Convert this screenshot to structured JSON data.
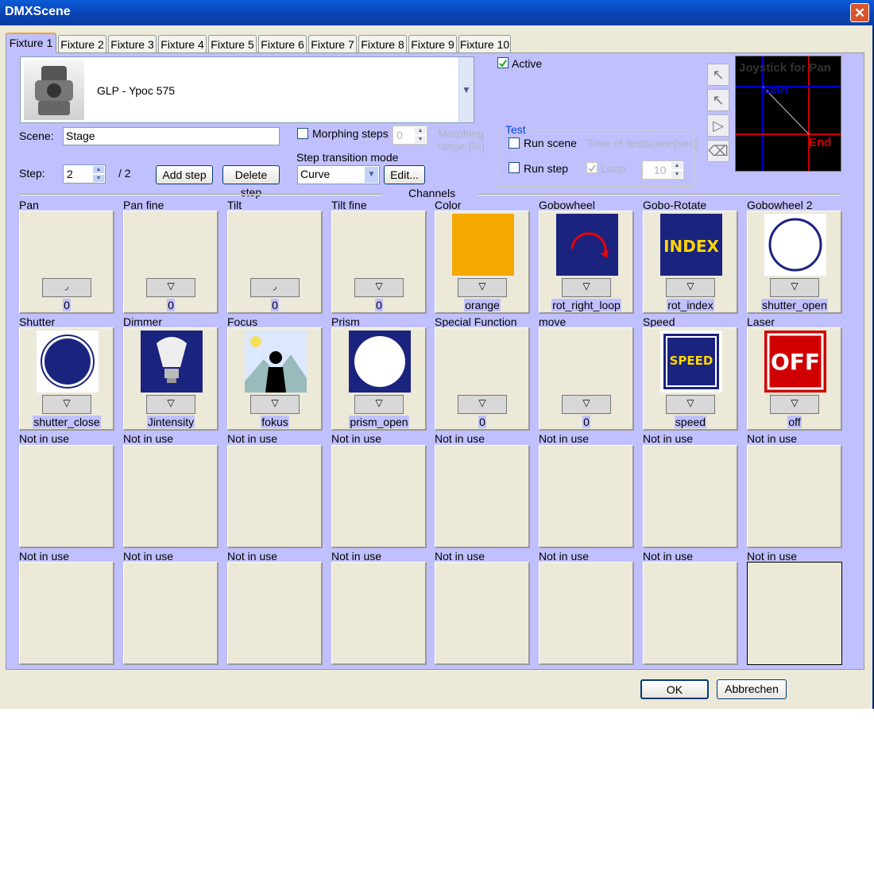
{
  "window": {
    "title": "DMXScene",
    "close": "✕"
  },
  "tabs": [
    "Fixture 1",
    "Fixture 2",
    "Fixture 3",
    "Fixture 4",
    "Fixture 5",
    "Fixture 6",
    "Fixture 7",
    "Fixture 8",
    "Fixture 9",
    "Fixture 10"
  ],
  "fixture": {
    "name": "GLP - Ypoc 575",
    "dropdown_icon": "chevron-down-icon"
  },
  "active": {
    "label": "Active",
    "checked": true
  },
  "scene": {
    "label": "Scene:",
    "value": "Stage"
  },
  "morphing": {
    "steps_label": "Morphing steps",
    "steps_value": "0",
    "range_label": "Morphing range [%]"
  },
  "step": {
    "label": "Step:",
    "value": "2",
    "of": "/ 2",
    "add": "Add step",
    "delete": "Delete step"
  },
  "transition": {
    "label": "Step transition mode",
    "value": "Curve",
    "edit": "Edit..."
  },
  "test": {
    "label": "Test",
    "run_scene": "Run scene",
    "time_label": "Time of testscene[sec]",
    "run_step": "Run step",
    "loop": "Loop",
    "loop_checked": true,
    "time_value": "10"
  },
  "joystick": {
    "title": "Joystick for Pan",
    "start": "Start",
    "end": "End"
  },
  "channels_label": "Channels",
  "channels": [
    {
      "label": "Pan",
      "value": "0",
      "icon": "pan-fader-icon"
    },
    {
      "label": "Pan fine",
      "value": "0",
      "icon": "none"
    },
    {
      "label": "Tilt",
      "value": "0",
      "icon": "tilt-fader-icon"
    },
    {
      "label": "Tilt fine",
      "value": "0",
      "icon": "none"
    },
    {
      "label": "Color",
      "value": "orange",
      "icon": "orange-color-swatch"
    },
    {
      "label": "Gobowheel",
      "value": "rot_right_loop",
      "icon": "rotate-right-icon"
    },
    {
      "label": "Gobo-Rotate",
      "value": "rot_index",
      "icon": "index-icon"
    },
    {
      "label": "Gobowheel 2",
      "value": "shutter_open",
      "icon": "open-circle-icon"
    },
    {
      "label": "Shutter",
      "value": "shutter_close",
      "icon": "closed-circle-icon"
    },
    {
      "label": "Dimmer",
      "value": "Jintensity",
      "icon": "bulb-icon"
    },
    {
      "label": "Focus",
      "value": "fokus",
      "icon": "focus-icon"
    },
    {
      "label": "Prism",
      "value": "prism_open",
      "icon": "prism-icon"
    },
    {
      "label": "Special Function",
      "value": "0",
      "icon": "none"
    },
    {
      "label": "move",
      "value": "0",
      "icon": "none"
    },
    {
      "label": "Speed",
      "value": "speed",
      "icon": "speed-icon"
    },
    {
      "label": "Laser",
      "value": "off",
      "icon": "off-icon"
    },
    {
      "label": "Not in use",
      "value": "",
      "icon": "none"
    },
    {
      "label": "Not in use",
      "value": "",
      "icon": "none"
    },
    {
      "label": "Not in use",
      "value": "",
      "icon": "none"
    },
    {
      "label": "Not in use",
      "value": "",
      "icon": "none"
    },
    {
      "label": "Not in use",
      "value": "",
      "icon": "none"
    },
    {
      "label": "Not in use",
      "value": "",
      "icon": "none"
    },
    {
      "label": "Not in use",
      "value": "",
      "icon": "none"
    },
    {
      "label": "Not in use",
      "value": "",
      "icon": "none"
    },
    {
      "label": "Not in use",
      "value": "",
      "icon": "none"
    },
    {
      "label": "Not in use",
      "value": "",
      "icon": "none"
    },
    {
      "label": "Not in use",
      "value": "",
      "icon": "none"
    },
    {
      "label": "Not in use",
      "value": "",
      "icon": "none"
    },
    {
      "label": "Not in use",
      "value": "",
      "icon": "none"
    },
    {
      "label": "Not in use",
      "value": "",
      "icon": "none"
    },
    {
      "label": "Not in use",
      "value": "",
      "icon": "none"
    },
    {
      "label": "Not in use",
      "value": "",
      "icon": "none"
    }
  ],
  "icon_text": {
    "index": "INDEX",
    "speed": "SPEED",
    "off": "OFF"
  },
  "buttons": {
    "ok": "OK",
    "cancel": "Abbrechen"
  },
  "colors": {
    "tab_bg": "#c0c0ff",
    "accent_orange": "#f5a623",
    "icon_navy": "#1a237e"
  }
}
